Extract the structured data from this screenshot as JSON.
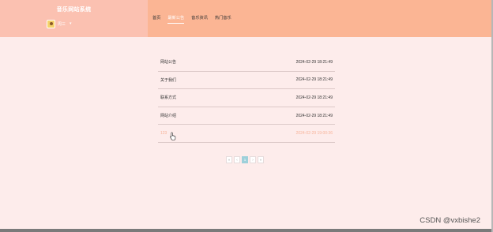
{
  "site": {
    "title": "音乐网站系统"
  },
  "user": {
    "name": "周三",
    "caret": "▾"
  },
  "nav": {
    "items": [
      {
        "label": "首页",
        "active": false
      },
      {
        "label": "最新公告",
        "active": true
      },
      {
        "label": "音乐资讯",
        "active": false
      },
      {
        "label": "热门音乐",
        "active": false
      }
    ]
  },
  "list": {
    "items": [
      {
        "title": "网站公告",
        "date": "2024-02-29 18:21:49"
      },
      {
        "title": "关于我们",
        "date": "2024-02-29 18:21:49"
      },
      {
        "title": "联系方式",
        "date": "2024-02-29 18:21:49"
      },
      {
        "title": "网站介绍",
        "date": "2024-02-29 18:21:49"
      },
      {
        "title": "123",
        "date": "2024-02-29 19:00:36"
      }
    ]
  },
  "pager": {
    "first": "«",
    "prev": "‹",
    "current": "1",
    "next": "›",
    "last": "»"
  },
  "watermark": "CSDN @vxbishe2",
  "colors": {
    "header": "#fbb594",
    "brand": "#fbc1b1",
    "background": "#fdeceb",
    "accent": "#f8b399",
    "pager_active": "#9ed0da"
  }
}
